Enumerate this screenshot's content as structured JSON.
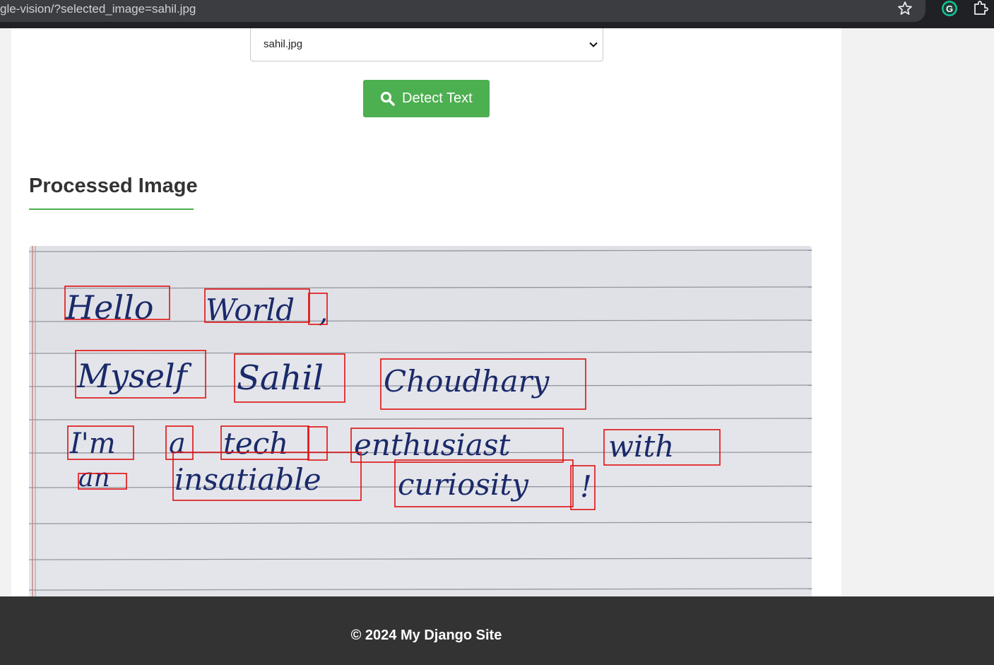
{
  "browser": {
    "url": "gle-vision/?selected_image=sahil.jpg"
  },
  "form": {
    "selected_image": "sahil.jpg",
    "detect_button_label": "Detect Text"
  },
  "section": {
    "title": "Processed Image"
  },
  "image": {
    "words": [
      "Hello",
      "World",
      ",",
      "Myself",
      "Sahil",
      "Choudhary",
      "I'm",
      "a",
      "tech",
      "enthusiast",
      "with",
      "an",
      "insatiable",
      "curiosity",
      "!"
    ],
    "box_color": "#e01010"
  },
  "footer": {
    "copyright": "© 2024 My Django Site"
  },
  "colors": {
    "accent": "#4caf50",
    "footer_bg": "#333333",
    "topbar_bg": "#202124"
  }
}
